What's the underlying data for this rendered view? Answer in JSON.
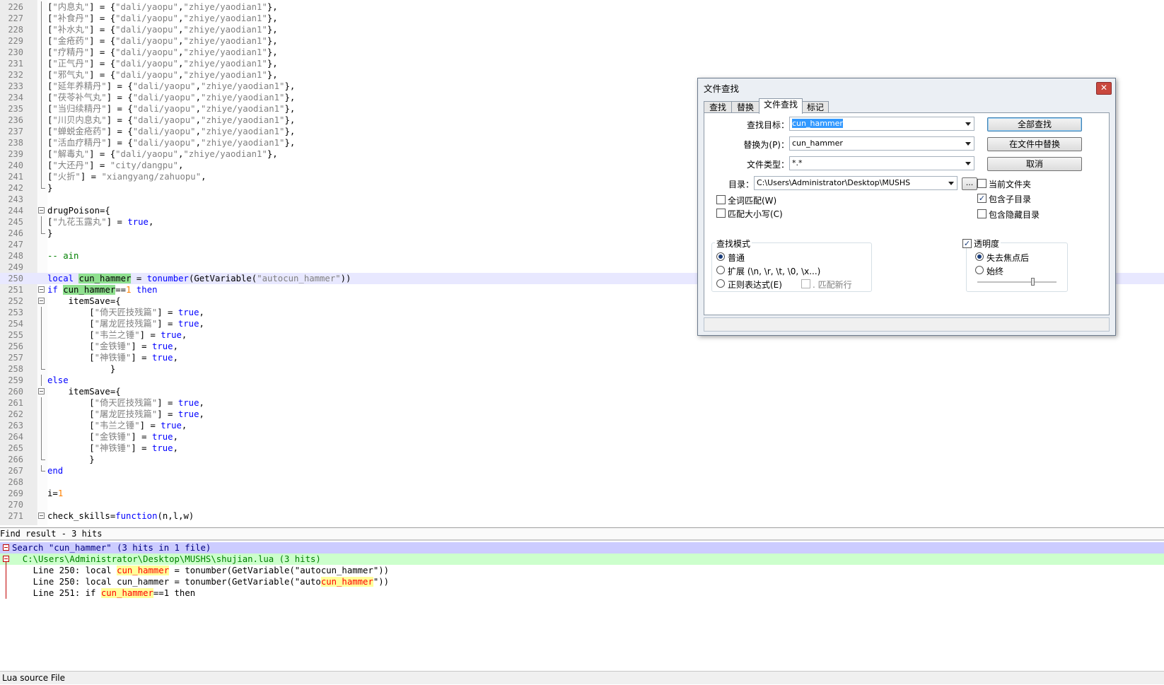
{
  "editor": {
    "lines": [
      {
        "n": "226",
        "fold": "vline",
        "html": "[<span class=\"s\">\"内息丸\"</span>] = {<span class=\"s\">\"dali/yaopu\"</span>,<span class=\"s\">\"zhiye/yaodian1\"</span>},"
      },
      {
        "n": "227",
        "fold": "vline",
        "html": "[<span class=\"s\">\"补食丹\"</span>] = {<span class=\"s\">\"dali/yaopu\"</span>,<span class=\"s\">\"zhiye/yaodian1\"</span>},"
      },
      {
        "n": "228",
        "fold": "vline",
        "html": "[<span class=\"s\">\"补水丸\"</span>] = {<span class=\"s\">\"dali/yaopu\"</span>,<span class=\"s\">\"zhiye/yaodian1\"</span>},"
      },
      {
        "n": "229",
        "fold": "vline",
        "html": "[<span class=\"s\">\"金疮药\"</span>] = {<span class=\"s\">\"dali/yaopu\"</span>,<span class=\"s\">\"zhiye/yaodian1\"</span>},"
      },
      {
        "n": "230",
        "fold": "vline",
        "html": "[<span class=\"s\">\"疗精丹\"</span>] = {<span class=\"s\">\"dali/yaopu\"</span>,<span class=\"s\">\"zhiye/yaodian1\"</span>},"
      },
      {
        "n": "231",
        "fold": "vline",
        "html": "[<span class=\"s\">\"正气丹\"</span>] = {<span class=\"s\">\"dali/yaopu\"</span>,<span class=\"s\">\"zhiye/yaodian1\"</span>},"
      },
      {
        "n": "232",
        "fold": "vline",
        "html": "[<span class=\"s\">\"邪气丸\"</span>] = {<span class=\"s\">\"dali/yaopu\"</span>,<span class=\"s\">\"zhiye/yaodian1\"</span>},"
      },
      {
        "n": "233",
        "fold": "vline",
        "html": "[<span class=\"s\">\"延年养精丹\"</span>] = {<span class=\"s\">\"dali/yaopu\"</span>,<span class=\"s\">\"zhiye/yaodian1\"</span>},"
      },
      {
        "n": "234",
        "fold": "vline",
        "html": "[<span class=\"s\">\"茯苓补气丸\"</span>] = {<span class=\"s\">\"dali/yaopu\"</span>,<span class=\"s\">\"zhiye/yaodian1\"</span>},"
      },
      {
        "n": "235",
        "fold": "vline",
        "html": "[<span class=\"s\">\"当归续精丹\"</span>] = {<span class=\"s\">\"dali/yaopu\"</span>,<span class=\"s\">\"zhiye/yaodian1\"</span>},"
      },
      {
        "n": "236",
        "fold": "vline",
        "html": "[<span class=\"s\">\"川贝内息丸\"</span>] = {<span class=\"s\">\"dali/yaopu\"</span>,<span class=\"s\">\"zhiye/yaodian1\"</span>},"
      },
      {
        "n": "237",
        "fold": "vline",
        "html": "[<span class=\"s\">\"蝉蜕金疮药\"</span>] = {<span class=\"s\">\"dali/yaopu\"</span>,<span class=\"s\">\"zhiye/yaodian1\"</span>},"
      },
      {
        "n": "238",
        "fold": "vline",
        "html": "[<span class=\"s\">\"活血疗精丹\"</span>] = {<span class=\"s\">\"dali/yaopu\"</span>,<span class=\"s\">\"zhiye/yaodian1\"</span>},"
      },
      {
        "n": "239",
        "fold": "vline",
        "html": "[<span class=\"s\">\"解毒丸\"</span>] = {<span class=\"s\">\"dali/yaopu\"</span>,<span class=\"s\">\"zhiye/yaodian1\"</span>},"
      },
      {
        "n": "240",
        "fold": "vline",
        "html": "[<span class=\"s\">\"大还丹\"</span>] = <span class=\"s\">\"city/dangpu\"</span>,"
      },
      {
        "n": "241",
        "fold": "vline",
        "html": "[<span class=\"s\">\"火折\"</span>] = <span class=\"s\">\"xiangyang/zahuopu\"</span>,"
      },
      {
        "n": "242",
        "fold": "end",
        "html": "}"
      },
      {
        "n": "243",
        "fold": "",
        "html": ""
      },
      {
        "n": "244",
        "fold": "box",
        "html": "drugPoison={"
      },
      {
        "n": "245",
        "fold": "vline",
        "html": "[<span class=\"s\">\"九花玉露丸\"</span>] = <span class=\"k\">true</span>,"
      },
      {
        "n": "246",
        "fold": "end",
        "html": "}"
      },
      {
        "n": "247",
        "fold": "",
        "html": ""
      },
      {
        "n": "248",
        "fold": "",
        "html": "<span class=\"c\">-- ain</span>"
      },
      {
        "n": "249",
        "fold": "",
        "html": ""
      },
      {
        "n": "250",
        "fold": "",
        "hl": true,
        "html": "<span class=\"k\">local</span> <span class=\"match\">cun_hammer</span> = <span class=\"k\">tonumber</span>(GetVariable(<span class=\"s\">\"autocun_hammer\"</span>))"
      },
      {
        "n": "251",
        "fold": "box",
        "html": "<span class=\"k\">if</span> <span class=\"match\">cun_hammer</span>==<span class=\"n\">1</span> <span class=\"k\">then</span>"
      },
      {
        "n": "252",
        "fold": "box",
        "html": "    itemSave={"
      },
      {
        "n": "253",
        "fold": "vline",
        "html": "        [<span class=\"s\">\"倚天匠技残篇\"</span>] = <span class=\"k\">true</span>,"
      },
      {
        "n": "254",
        "fold": "vline",
        "html": "        [<span class=\"s\">\"屠龙匠技残篇\"</span>] = <span class=\"k\">true</span>,"
      },
      {
        "n": "255",
        "fold": "vline",
        "html": "        [<span class=\"s\">\"韦兰之锤\"</span>] = <span class=\"k\">true</span>,"
      },
      {
        "n": "256",
        "fold": "vline",
        "html": "        [<span class=\"s\">\"金铁锤\"</span>] = <span class=\"k\">true</span>,"
      },
      {
        "n": "257",
        "fold": "vline",
        "html": "        [<span class=\"s\">\"神铁锤\"</span>] = <span class=\"k\">true</span>,"
      },
      {
        "n": "258",
        "fold": "end",
        "html": "            }"
      },
      {
        "n": "259",
        "fold": "vline",
        "html": "<span class=\"k\">else</span>"
      },
      {
        "n": "260",
        "fold": "box",
        "html": "    itemSave={"
      },
      {
        "n": "261",
        "fold": "vline",
        "html": "        [<span class=\"s\">\"倚天匠技残篇\"</span>] = <span class=\"k\">true</span>,"
      },
      {
        "n": "262",
        "fold": "vline",
        "html": "        [<span class=\"s\">\"屠龙匠技残篇\"</span>] = <span class=\"k\">true</span>,"
      },
      {
        "n": "263",
        "fold": "vline",
        "html": "        [<span class=\"s\">\"韦兰之锤\"</span>] = <span class=\"k\">true</span>,"
      },
      {
        "n": "264",
        "fold": "vline",
        "html": "        [<span class=\"s\">\"金铁锤\"</span>] = <span class=\"k\">true</span>,"
      },
      {
        "n": "265",
        "fold": "vline",
        "html": "        [<span class=\"s\">\"神铁锤\"</span>] = <span class=\"k\">true</span>,"
      },
      {
        "n": "266",
        "fold": "end",
        "html": "        }"
      },
      {
        "n": "267",
        "fold": "end",
        "html": "<span class=\"k\">end</span>"
      },
      {
        "n": "268",
        "fold": "",
        "html": ""
      },
      {
        "n": "269",
        "fold": "",
        "html": "i=<span class=\"n\">1</span>"
      },
      {
        "n": "270",
        "fold": "",
        "html": ""
      },
      {
        "n": "271",
        "fold": "box",
        "html": "check_skills=<span class=\"k\">function</span>(n,l,w)"
      }
    ]
  },
  "results": {
    "header": "Find result - 3 hits",
    "lines": [
      {
        "kind": "h1",
        "html": "Search \"cun_hammer\" (3 hits in 1 file)"
      },
      {
        "kind": "h2",
        "html": "  C:\\Users\\Administrator\\Desktop\\MUSHS\\shujian.lua (3 hits)"
      },
      {
        "kind": "hit",
        "html": "    Line 250: local <span class=\"hit\">cun_hammer</span> = tonumber(GetVariable(\"autocun_hammer\"))"
      },
      {
        "kind": "hit",
        "html": "    Line 250: local cun_hammer = tonumber(GetVariable(\"auto<span class=\"hit\">cun_hammer</span>\"))"
      },
      {
        "kind": "hit",
        "html": "    Line 251: if <span class=\"hit\">cun_hammer</span>==1 then"
      }
    ]
  },
  "status": {
    "text": "Lua source File"
  },
  "dialog": {
    "title": "文件查找",
    "close": "✕",
    "tabs": [
      "查找",
      "替换",
      "文件查找",
      "标记"
    ],
    "find_label": "查找目标：",
    "find_value": "cun_hammer",
    "replace_label": "替换为(P)：",
    "replace_value": "cun_hammer",
    "filter_label": "文件类型：",
    "filter_value": "*.*",
    "dir_label": "目录：",
    "dir_value": "C:\\Users\\Administrator\\Desktop\\MUSHS",
    "browse": "...",
    "btn_find_all": "全部查找",
    "btn_replace_in_files": "在文件中替换",
    "btn_cancel": "取消",
    "whole_word": "全词匹配(W)",
    "match_case": "匹配大小写(C)",
    "current_folder": "当前文件夹",
    "include_subfolders": "包含子目录",
    "include_hidden": "包含隐藏目录",
    "search_mode_label": "查找模式",
    "mode_normal": "普通",
    "mode_extended": "扩展 (\\n, \\r, \\t, \\0, \\x...)",
    "mode_regex": "正则表达式(E)",
    "dot_newline": ". 匹配新行",
    "transparency": "透明度",
    "on_lose_focus": "失去焦点后",
    "always": "始终"
  }
}
